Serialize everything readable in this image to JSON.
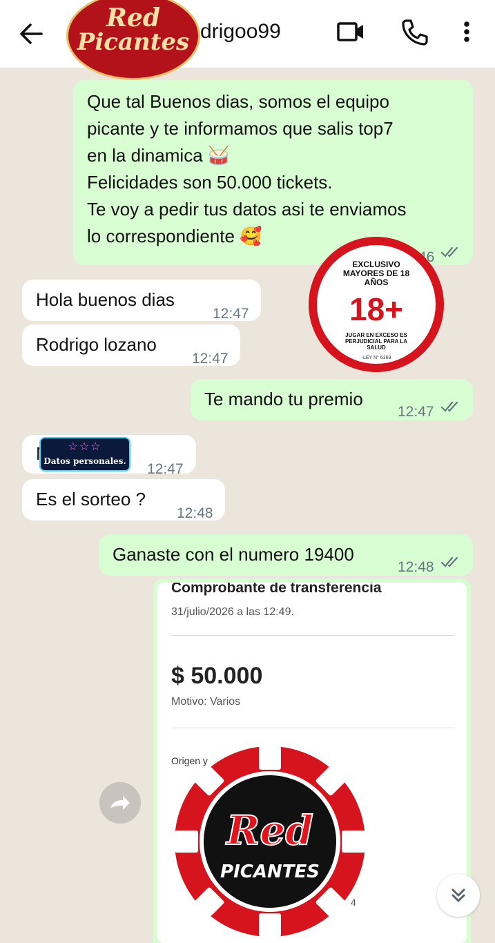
{
  "header": {
    "contact_name": "drigoo99",
    "logo": {
      "line1": "Red",
      "line2": "Picantes"
    },
    "icons": [
      "back-arrow-icon",
      "video-call-icon",
      "phone-icon",
      "more-vert-icon"
    ]
  },
  "messages": [
    {
      "id": "m1",
      "direction": "out",
      "lines": [
        "Que tal Buenos dias, somos el equipo",
        "picante y te informamos que salis top7",
        "en la dinamica 🥁",
        "Felicidades son 50.000 tickets.",
        "Te voy a pedir tus datos asi te enviamos",
        "lo correspondiente 🥰"
      ],
      "time": "12:46",
      "time_visible": "46"
    },
    {
      "id": "m2",
      "direction": "in",
      "text": "Hola buenos dias",
      "time": "12:47"
    },
    {
      "id": "m3",
      "direction": "in",
      "text": "Rodrigo lozano",
      "time": "12:47"
    },
    {
      "id": "m4",
      "direction": "out",
      "text": "Te mando tu premio",
      "time": "12:47"
    },
    {
      "id": "m5",
      "direction": "in",
      "text": "N",
      "time": "12:47"
    },
    {
      "id": "m6",
      "direction": "in",
      "text": "Es el sorteo ?",
      "time": "12:48"
    },
    {
      "id": "m7",
      "direction": "out",
      "text": "Ganaste con el numero 19400",
      "time": "12:48"
    }
  ],
  "age_seal": {
    "top": "EXCLUSIVO MAYORES DE 18 AÑOS",
    "top_lines": [
      "EXCLUSIVO",
      "MAYORES DE 18",
      "AÑOS"
    ],
    "big": "18+",
    "bottom_lines": [
      "JUGAR EN EXCESO ES",
      "PERJUDICIAL PARA LA",
      "SALUD"
    ],
    "law": "-LEY N° 6169"
  },
  "datos_sticker": {
    "stars": "☆☆☆",
    "label": "Datos personales."
  },
  "receipt": {
    "title": "Comprobante de transferencia",
    "date": "31/julio/2026 a las 12:49.",
    "amount": "$ 50.000",
    "motivo": "Motivo: Varios",
    "origen": "Origen y",
    "footer_digit": "4"
  },
  "chip_logo": {
    "line1": "Red",
    "line2": "PICANTES"
  },
  "colors": {
    "outgoing_bubble": "#d9fdd3",
    "incoming_bubble": "#ffffff",
    "read_ticks": "#667781",
    "brand_red": "#d5141d",
    "chat_bg": "#ece5db"
  }
}
